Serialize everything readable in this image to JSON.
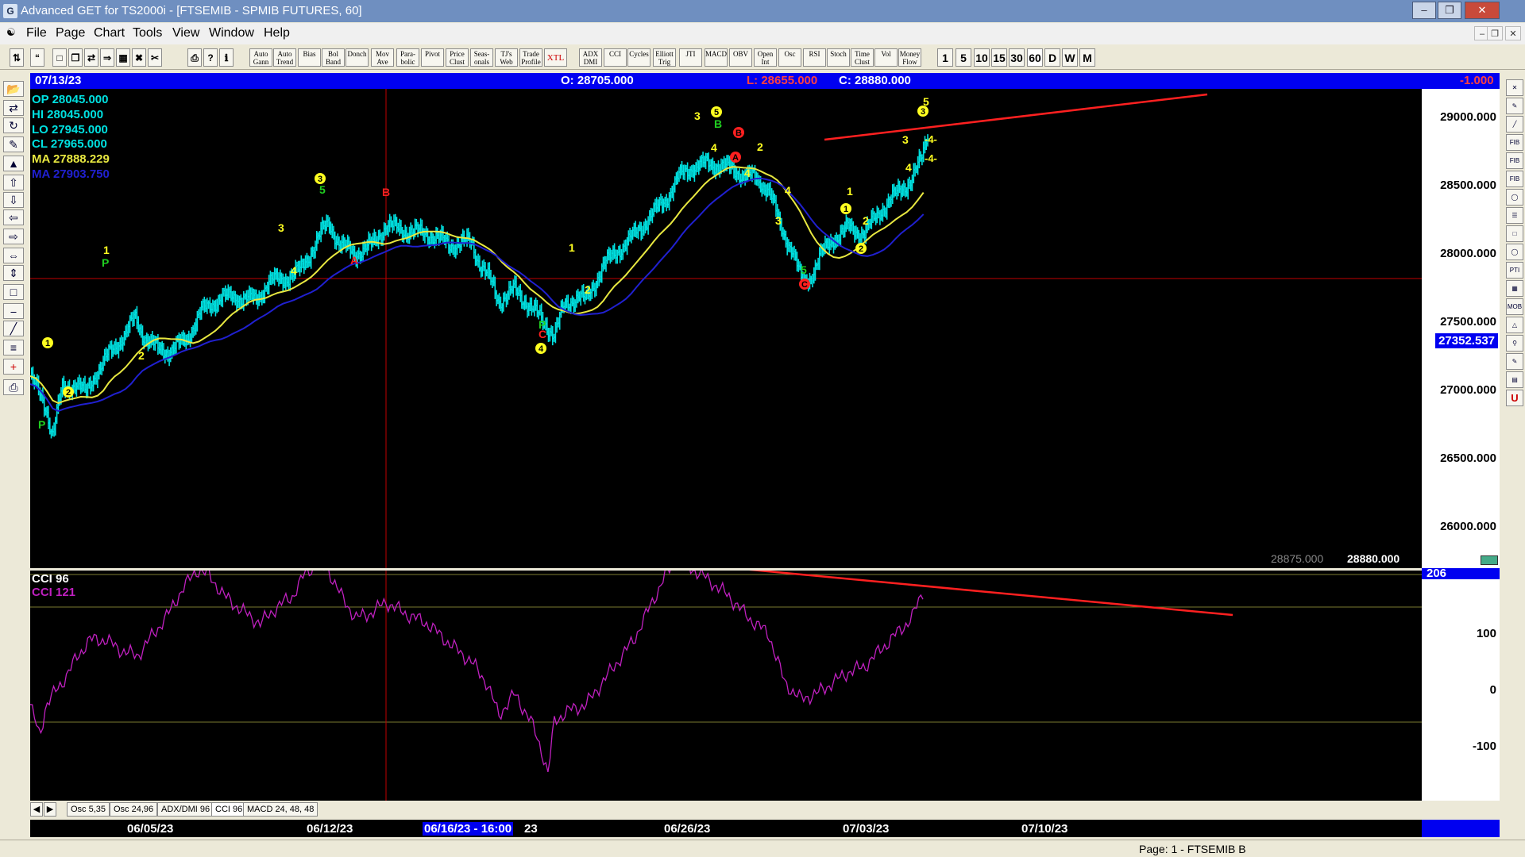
{
  "window": {
    "title": "Advanced GET for TS2000i - [FTSEMIB - SPMIB FUTURES, 60]"
  },
  "menu": [
    "File",
    "Page",
    "Chart",
    "Tools",
    "View",
    "Window",
    "Help"
  ],
  "toolbar": {
    "studies": [
      "Auto Gann",
      "Auto Trend",
      "Bias",
      "Bol Band",
      "Donch",
      "Mov Ave",
      "Para- bolic",
      "Pivot",
      "Price Clust",
      "Seas- onals",
      "TJ's Web",
      "Trade Profile",
      "XTL",
      "ADX DMI",
      "CCI",
      "Cycles",
      "Elliott Trig",
      "JTI",
      "MACD",
      "OBV",
      "Open Int",
      "Osc",
      "RSI",
      "Stoch",
      "Time Clust",
      "Vol",
      "Money Flow"
    ],
    "intervals": [
      "1",
      "5",
      "10",
      "15",
      "30",
      "60",
      "D",
      "W",
      "M"
    ]
  },
  "status": {
    "date": "07/13/23",
    "open": "O: 28705.000",
    "low": "L: 28655.000",
    "close": "C: 28880.000",
    "change": "-1.000"
  },
  "readout": {
    "op": "OP 28045.000",
    "hi": "HI 28045.000",
    "lo": "LO 27945.000",
    "cl": "CL 27965.000",
    "ma1": "MA 27888.229",
    "ma2": "MA 27903.750"
  },
  "price_scale": {
    "ticks": [
      "29000.000",
      "28500.000",
      "28000.000",
      "27500.000",
      "27000.000",
      "26500.000",
      "26000.000"
    ],
    "cursor": "27352.537",
    "bottom_left": "28875.000",
    "bottom_right": "28880.000"
  },
  "cci_panel": {
    "label1": "CCI 96",
    "label2": "CCI 121",
    "ticks": [
      "206",
      "100",
      "0",
      "-100"
    ]
  },
  "tabs": [
    "Osc 5,35",
    "Osc 24,96",
    "ADX/DMI 96",
    "CCI 96",
    "MACD 24, 48, 48"
  ],
  "dates": {
    "d1": "06/05/23",
    "d2": "06/12/23",
    "cursor": "06/16/23 - 16:00",
    "d2b": "23",
    "d3": "06/26/23",
    "d4": "07/03/23",
    "d5": "07/10/23"
  },
  "wave_labels": {
    "p": "P",
    "c": "C",
    "a": "A",
    "b": "B",
    "n1": "1",
    "n2": "2",
    "n3": "3",
    "n4": "4",
    "n5": "5",
    "m4": "-4-"
  },
  "footer": {
    "page": "Page: 1 - FTSEMIB B"
  },
  "colors": {
    "chart_bg": "#000000",
    "bars": "#00e0e0",
    "ma_slow": "#2020d0",
    "ma_fast": "#e8e840",
    "cci": "#c020c0",
    "trend": "#ff2020",
    "label_yellow": "#ffff20"
  }
}
